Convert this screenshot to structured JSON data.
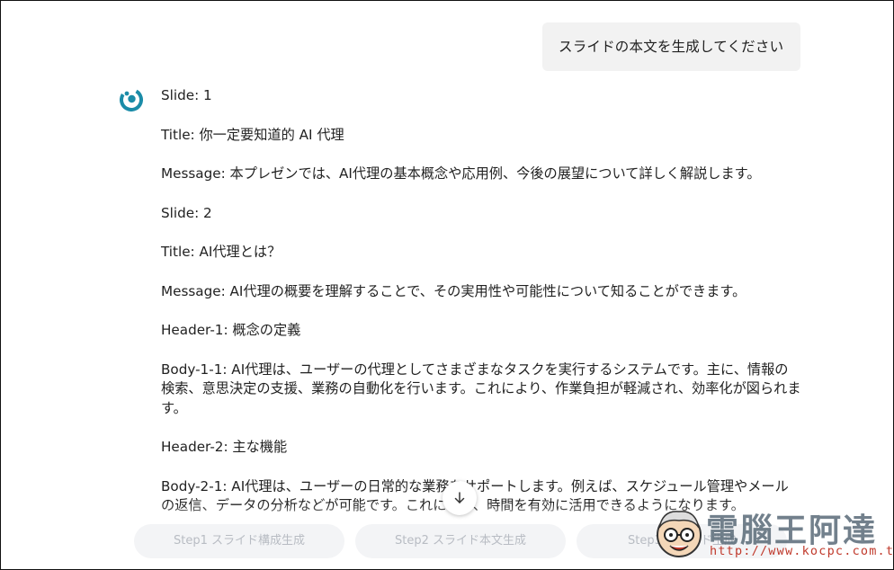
{
  "user_message": "スライドの本文を生成してください",
  "assistant": {
    "avatar_icon": "swirl-logo-icon",
    "accent_color": "#1b8ca8",
    "lines": [
      "Slide: 1",
      "Title: 你一定要知道的 AI 代理",
      "Message: 本プレゼンでは、AI代理の基本概念や応用例、今後の展望について詳しく解説します。",
      "Slide: 2",
      "Title: AI代理とは？",
      "Message: AI代理の概要を理解することで、その実用性や可能性について知ることができます。",
      "Header-1: 概念の定義",
      "Body-1-1: AI代理は、ユーザーの代理としてさまざまなタスクを実行するシステムです。主に、情報の検索、意思決定の支援、業務の自動化を行います。これにより、作業負担が軽減され、効率化が図られます。",
      "Header-2: 主な機能",
      "Body-2-1: AI代理は、ユーザーの日常的な業務をサポートします。例えば、スケジュール管理やメールの返信、データの分析などが可能です。これにより、時間を有効に活用できるようになります。"
    ]
  },
  "scroll_button_icon": "arrow-down-icon",
  "steps": [
    {
      "label": "Step1 スライド構成生成"
    },
    {
      "label": "Step2 スライド本文生成"
    },
    {
      "label": "Step3 スライド生成"
    }
  ],
  "watermark": {
    "title": "電腦王阿達",
    "url": "http://www.kocpc.com.tw",
    "mascot_icon": "mascot-face-icon"
  }
}
